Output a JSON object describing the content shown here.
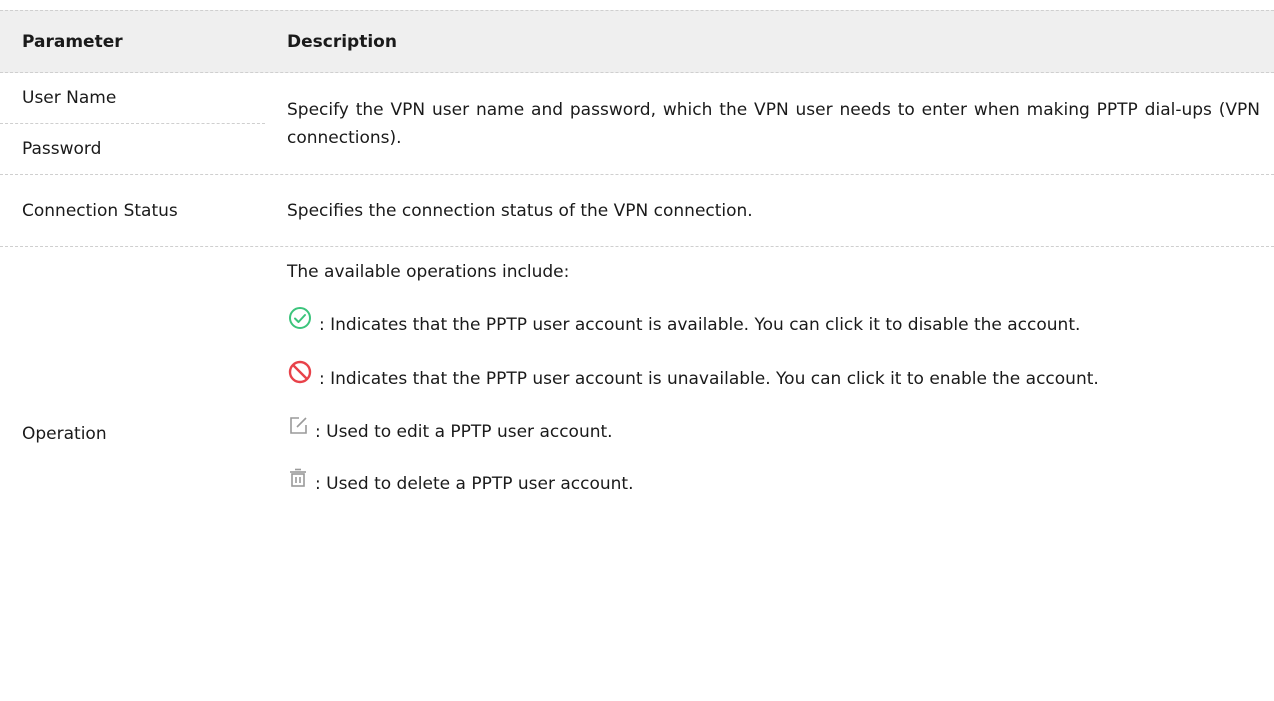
{
  "table": {
    "header": {
      "parameter": "Parameter",
      "description": "Description"
    },
    "rows": {
      "user_name": "User Name",
      "password": "Password",
      "user_pass_desc": "Specify the VPN user name and password, which the VPN user needs to enter when making PPTP dial-ups (VPN connections).",
      "connection_status": "Connection Status",
      "connection_status_desc": "Specifies the connection status of the VPN connection.",
      "operation": "Operation",
      "operation_intro": "The available operations include:",
      "op_enabled": ": Indicates that the PPTP user account is available. You can click it to disable the account.",
      "op_disabled": ": Indicates that the PPTP user account is unavailable. You can click it to enable the account.",
      "op_edit": ": Used to edit a PPTP user account.",
      "op_delete": ": Used to delete a PPTP user account."
    }
  },
  "icons": {
    "enabled": "check-circle-icon",
    "disabled": "prohibited-icon",
    "edit": "edit-icon",
    "delete": "trash-icon"
  },
  "colors": {
    "enabled_green": "#3cc47c",
    "disabled_red": "#e8424a",
    "icon_gray": "#9a9a9a",
    "header_bg": "#efefef"
  }
}
